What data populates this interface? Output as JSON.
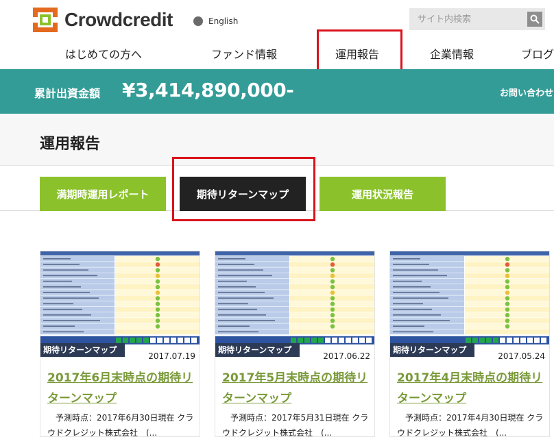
{
  "brand": {
    "name": "Crowdcredit",
    "colors": {
      "orange": "#e36a1e",
      "green": "#8bc22c",
      "teal": "#339c97",
      "dark": "#2d3a55",
      "red": "#d9121b"
    }
  },
  "header": {
    "language_label": "English",
    "search_placeholder": "サイト内検索",
    "search_icon": "search-icon"
  },
  "nav": {
    "items": [
      "はじめての方へ",
      "ファンド情報",
      "運用報告",
      "企業情報",
      "ブログ"
    ]
  },
  "band": {
    "label": "累計出資金額",
    "value": "¥3,414,890,000-",
    "contact": "お問い合わせ"
  },
  "page": {
    "title": "運用報告"
  },
  "tabs": [
    {
      "label": "満期時運用レポート"
    },
    {
      "label": "期待リターンマップ"
    },
    {
      "label": "運用状況報告"
    }
  ],
  "cards": [
    {
      "badge": "期待リターンマップ",
      "date": "2017.07.19",
      "title": "2017年6月末時点の期待リターンマップ",
      "desc": "予測時点：2017年6月30日現在 クラウドクレジット株式会社　(..."
    },
    {
      "badge": "期待リターンマップ",
      "date": "2017.06.22",
      "title": "2017年5月末時点の期待リターンマップ",
      "desc": "予測時点：2017年5月31日現在 クラウドクレジット株式会社　(..."
    },
    {
      "badge": "期待リターンマップ",
      "date": "2017.05.24",
      "title": "2017年4月末時点の期待リターンマップ",
      "desc": "予測時点：2017年4月30日現在 クラウドクレジット株式会社　(..."
    }
  ]
}
